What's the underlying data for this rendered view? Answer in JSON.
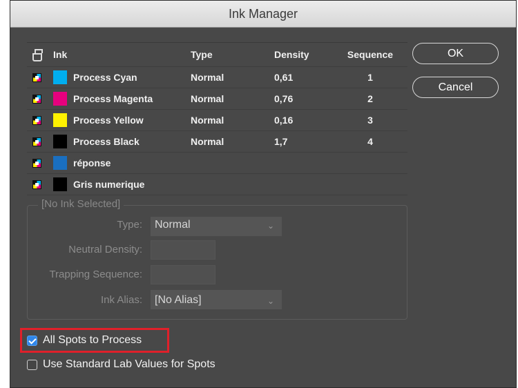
{
  "window": {
    "title": "Ink Manager"
  },
  "table": {
    "headers": {
      "ink": "Ink",
      "type": "Type",
      "density": "Density",
      "sequence": "Sequence"
    },
    "rows": [
      {
        "name": "Process Cyan",
        "color": "#00aeef",
        "type": "Normal",
        "density": "0,61",
        "sequence": "1"
      },
      {
        "name": "Process Magenta",
        "color": "#e6007e",
        "type": "Normal",
        "density": "0,76",
        "sequence": "2"
      },
      {
        "name": "Process Yellow",
        "color": "#fff200",
        "type": "Normal",
        "density": "0,16",
        "sequence": "3"
      },
      {
        "name": "Process Black",
        "color": "#000000",
        "type": "Normal",
        "density": "1,7",
        "sequence": "4"
      },
      {
        "name": "réponse",
        "color": "#1a6fc0",
        "type": "",
        "density": "",
        "sequence": ""
      },
      {
        "name": "Gris numerique",
        "color": "#000000",
        "type": "",
        "density": "",
        "sequence": ""
      }
    ]
  },
  "buttons": {
    "ok": "OK",
    "cancel": "Cancel"
  },
  "group": {
    "legend": "[No Ink Selected]",
    "type_label": "Type:",
    "type_value": "Normal",
    "neutral_density_label": "Neutral Density:",
    "neutral_density_value": "",
    "trapping_sequence_label": "Trapping Sequence:",
    "trapping_sequence_value": "",
    "ink_alias_label": "Ink Alias:",
    "ink_alias_value": "[No Alias]"
  },
  "options": {
    "all_spots_to_process": {
      "label": "All Spots to Process",
      "checked": true
    },
    "use_standard_lab": {
      "label": "Use Standard Lab Values for Spots",
      "checked": false
    }
  },
  "colors": {
    "dialog_bg": "#484848",
    "highlight": "#e0202a",
    "checkbox_accent": "#2f86ea"
  }
}
